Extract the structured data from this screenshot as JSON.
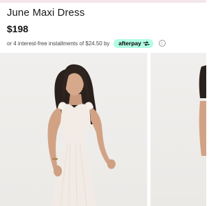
{
  "product": {
    "title": "June Maxi Dress",
    "price": "$198"
  },
  "installments": {
    "text": "or 4 interest-free installments of $24.50 by",
    "provider": "afterpay",
    "info_glyph": "i"
  },
  "gallery": {
    "photos": [
      {
        "description_icon": "model-photo"
      },
      {
        "description_icon": "model-photo"
      }
    ]
  },
  "colors": {
    "afterpay_mint": "#b2fce4",
    "dress": "#f3ece6",
    "photo_background": "#eeece9"
  }
}
